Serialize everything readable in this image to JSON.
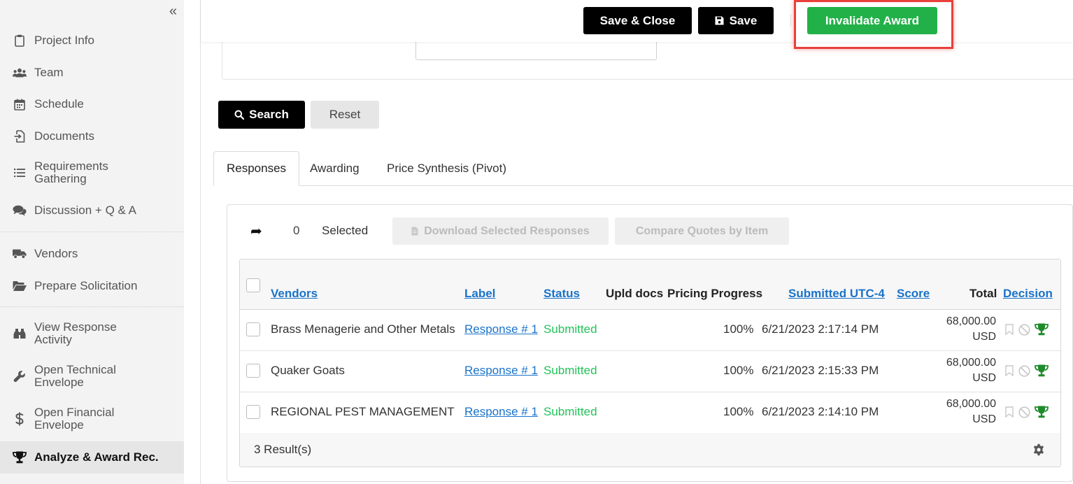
{
  "sidebar": {
    "items": [
      {
        "label": "Project Info",
        "icon": "clipboard-icon"
      },
      {
        "label": "Team",
        "icon": "users-icon"
      },
      {
        "label": "Schedule",
        "icon": "calendar-icon"
      },
      {
        "label": "Documents",
        "icon": "file-import-icon"
      },
      {
        "label": "Requirements Gathering",
        "icon": "list-icon"
      },
      {
        "label": "Discussion + Q & A",
        "icon": "comments-icon"
      },
      {
        "label": "Vendors",
        "icon": "truck-icon"
      },
      {
        "label": "Prepare Solicitation",
        "icon": "folder-open-icon"
      },
      {
        "label": "View Response Activity",
        "icon": "binoculars-icon"
      },
      {
        "label": "Open Technical Envelope",
        "icon": "wrench-icon"
      },
      {
        "label": "Open Financial Envelope",
        "icon": "dollar-icon"
      },
      {
        "label": "Analyze & Award Rec.",
        "icon": "trophy-icon"
      }
    ],
    "collapse_glyph": "«"
  },
  "toolbar": {
    "save_close_label": "Save & Close",
    "save_label": "Save",
    "invalidate_label": "Invalidate Award"
  },
  "search": {
    "search_label": "Search",
    "reset_label": "Reset"
  },
  "tabs": [
    {
      "label": "Responses",
      "active": true
    },
    {
      "label": "Awarding",
      "active": false
    },
    {
      "label": "Price Synthesis (Pivot)",
      "active": false
    }
  ],
  "selection": {
    "arrow": "➦",
    "count": "0",
    "label": "Selected",
    "download_label": "Download Selected Responses",
    "compare_label": "Compare Quotes by Item"
  },
  "table": {
    "headers": {
      "vendors": "Vendors",
      "label": "Label",
      "status": "Status",
      "upld_docs": "Upld docs",
      "pricing_progress": "Pricing Progress",
      "submitted": "Submitted UTC-4",
      "score": "Score",
      "total": "Total",
      "decision": "Decision"
    },
    "rows": [
      {
        "vendor": "Brass Menagerie and Other Metals",
        "label": "Response # 1",
        "status": "Submitted",
        "progress": "100%",
        "submitted": "6/21/2023 2:17:14 PM",
        "total_amount": "68,000.00",
        "total_currency": "USD"
      },
      {
        "vendor": "Quaker Goats",
        "label": "Response # 1",
        "status": "Submitted",
        "progress": "100%",
        "submitted": "6/21/2023 2:15:33 PM",
        "total_amount": "68,000.00",
        "total_currency": "USD"
      },
      {
        "vendor": "REGIONAL PEST MANAGEMENT",
        "label": "Response # 1",
        "status": "Submitted",
        "progress": "100%",
        "submitted": "6/21/2023 2:14:10 PM",
        "total_amount": "68,000.00",
        "total_currency": "USD"
      }
    ],
    "result_count": "3 Result(s)"
  },
  "colors": {
    "accent_green": "#22b148",
    "link_blue": "#1a73c9",
    "status_green": "#22c25a",
    "highlight_red": "#e8403b",
    "trophy_green": "#1e8a2a"
  }
}
